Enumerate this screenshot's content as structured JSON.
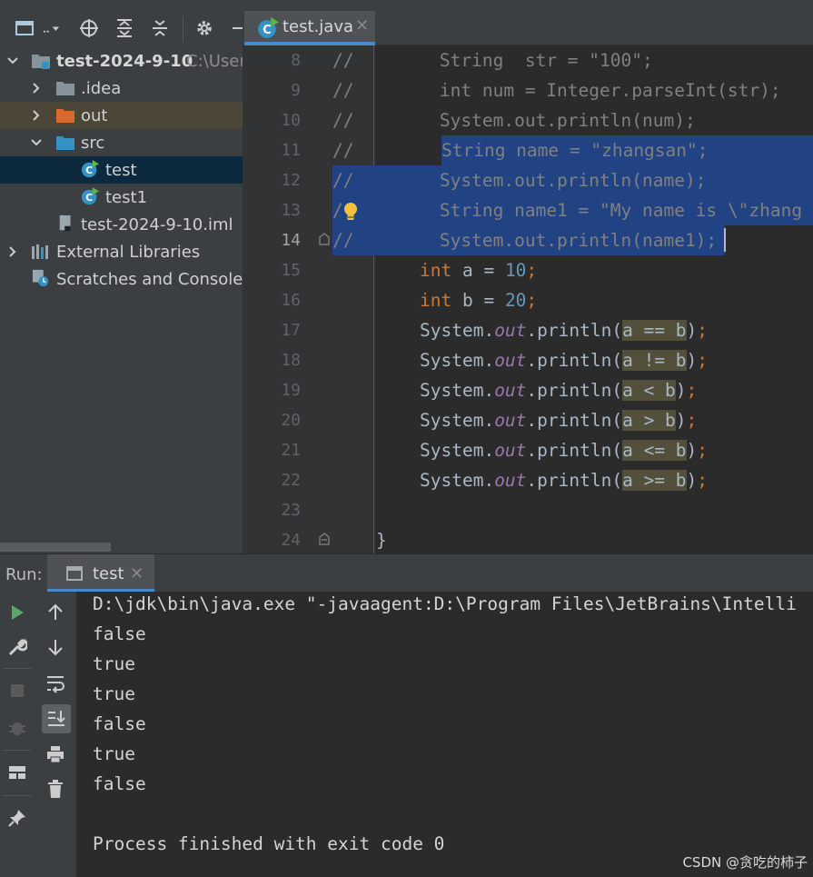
{
  "project": {
    "root_label": "test-2024-9-10",
    "root_path": "C:\\User",
    "items": [
      {
        "label": ".idea"
      },
      {
        "label": "out"
      },
      {
        "label": "src"
      },
      {
        "label": "test"
      },
      {
        "label": "test1"
      },
      {
        "label": "test-2024-9-10.iml"
      },
      {
        "label": "External Libraries"
      },
      {
        "label": "Scratches and Consoles"
      }
    ]
  },
  "editor": {
    "tab_label": "test.java",
    "line_numbers": [
      "8",
      "9",
      "10",
      "11",
      "12",
      "13",
      "14",
      "15",
      "16",
      "17",
      "18",
      "19",
      "20",
      "21",
      "22",
      "23",
      "24"
    ],
    "lines": {
      "l8_a": "//",
      "l8_b": "        String  str = \"100\";",
      "l9_a": "//",
      "l9_b": "        int num = Integer.parseInt(str);",
      "l10_a": "//",
      "l10_b": "        System.out.println(num);",
      "l11_a": "//",
      "l11_b": "String name = \"zhangsan\";",
      "l12_a": "//",
      "l12_b": "        System.out.println(name);",
      "l13_a": "/",
      "l13_b": "        String name1 = \"My name is \\\"zhang",
      "l14_a": "//",
      "l14_b": "        System.out.println(name1);",
      "l15": [
        "int",
        " a = ",
        "10",
        ";"
      ],
      "l16": [
        "int",
        " b = ",
        "20",
        ";"
      ],
      "sys": "System.",
      "out": "out",
      "println": ".println(",
      "l17": "a == b",
      "l18": "a != b",
      "l19": "a < b",
      "l20": "a > b",
      "l21": "a <= b",
      "l22": "a >= b",
      "semi": ");",
      "close": ")",
      "l24": "}"
    }
  },
  "run": {
    "label": "Run:",
    "tab_label": "test",
    "output": [
      "D:\\jdk\\bin\\java.exe \"-javaagent:D:\\Program Files\\JetBrains\\Intelli",
      "false",
      "true",
      "true",
      "false",
      "true",
      "false",
      "",
      "Process finished with exit code 0"
    ]
  },
  "watermark": "CSDN @贪吃的柿子"
}
